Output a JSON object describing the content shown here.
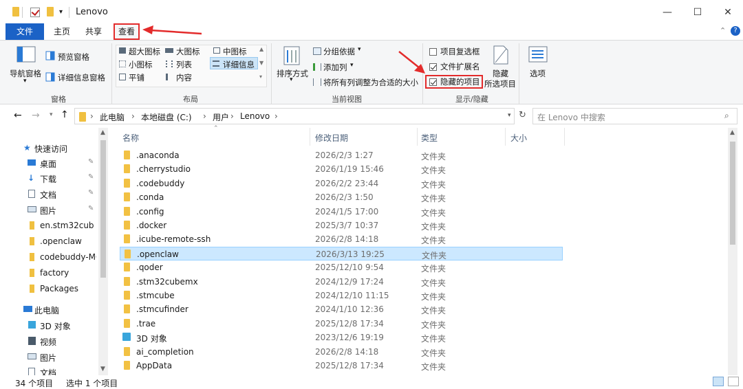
{
  "window": {
    "title": "Lenovo",
    "minimize": "—",
    "maximize": "☐",
    "close": "✕"
  },
  "tabs": {
    "file": "文件",
    "home": "主页",
    "share": "共享",
    "view": "查看"
  },
  "ribbon": {
    "panes": {
      "nav_pane": "导航窗格",
      "preview_pane": "预览窗格",
      "details_pane": "详细信息窗格",
      "group": "窗格"
    },
    "layout": {
      "extra_large": "超大图标",
      "large": "大图标",
      "medium": "中图标",
      "small": "小图标",
      "list": "列表",
      "details": "详细信息",
      "tiles": "平铺",
      "content": "内容",
      "group": "布局"
    },
    "current_view": {
      "sort": "排序方式",
      "group_by": "分组依据",
      "add_columns": "添加列",
      "fit_columns": "将所有列调整为合适的大小",
      "group": "当前视图"
    },
    "show_hide": {
      "item_checkboxes": "项目复选框",
      "file_extensions": "文件扩展名",
      "hidden_items": "隐藏的项目",
      "hide_selected_1": "隐藏",
      "hide_selected_2": "所选项目",
      "group": "显示/隐藏"
    },
    "options": "选项"
  },
  "address": {
    "crumbs": [
      "此电脑",
      "本地磁盘 (C:)",
      "用户",
      "Lenovo"
    ],
    "search_placeholder": "在 Lenovo 中搜索"
  },
  "nav": {
    "quick_access": "快速访问",
    "items": [
      {
        "label": "桌面",
        "pinned": true
      },
      {
        "label": "下载",
        "pinned": true
      },
      {
        "label": "文档",
        "pinned": true
      },
      {
        "label": "图片",
        "pinned": true
      },
      {
        "label": "en.stm32cub",
        "pinned": true
      },
      {
        "label": ".openclaw",
        "pinned": false
      },
      {
        "label": "codebuddy-MC",
        "pinned": false
      },
      {
        "label": "factory",
        "pinned": false
      },
      {
        "label": "Packages",
        "pinned": false
      }
    ],
    "this_pc": "此电脑",
    "pc_items": [
      {
        "label": "3D 对象"
      },
      {
        "label": "视频"
      },
      {
        "label": "图片"
      },
      {
        "label": "文档"
      }
    ]
  },
  "columns": {
    "name": "名称",
    "date": "修改日期",
    "type": "类型",
    "size": "大小"
  },
  "files": [
    {
      "name": ".anaconda",
      "date": "2026/2/3 1:27",
      "type": "文件夹"
    },
    {
      "name": ".cherrystudio",
      "date": "2026/1/19 15:46",
      "type": "文件夹"
    },
    {
      "name": ".codebuddy",
      "date": "2026/2/2 23:44",
      "type": "文件夹"
    },
    {
      "name": ".conda",
      "date": "2026/2/3 1:50",
      "type": "文件夹"
    },
    {
      "name": ".config",
      "date": "2024/1/5 17:00",
      "type": "文件夹"
    },
    {
      "name": ".docker",
      "date": "2025/3/7 10:37",
      "type": "文件夹"
    },
    {
      "name": ".icube-remote-ssh",
      "date": "2026/2/8 14:18",
      "type": "文件夹"
    },
    {
      "name": ".openclaw",
      "date": "2026/3/13 19:25",
      "type": "文件夹"
    },
    {
      "name": ".qoder",
      "date": "2025/12/10 9:54",
      "type": "文件夹"
    },
    {
      "name": ".stm32cubemx",
      "date": "2024/12/9 17:24",
      "type": "文件夹"
    },
    {
      "name": ".stmcube",
      "date": "2024/12/10 11:15",
      "type": "文件夹"
    },
    {
      "name": ".stmcufinder",
      "date": "2024/1/10 12:36",
      "type": "文件夹"
    },
    {
      "name": ".trae",
      "date": "2025/12/8 17:34",
      "type": "文件夹"
    },
    {
      "name": "3D 对象",
      "date": "2023/12/6 19:19",
      "type": "文件夹"
    },
    {
      "name": "ai_completion",
      "date": "2026/2/8 14:18",
      "type": "文件夹"
    },
    {
      "name": "AppData",
      "date": "2025/12/8 17:34",
      "type": "文件夹"
    }
  ],
  "status": {
    "count": "34 个项目",
    "selected": "选中 1 个项目"
  }
}
